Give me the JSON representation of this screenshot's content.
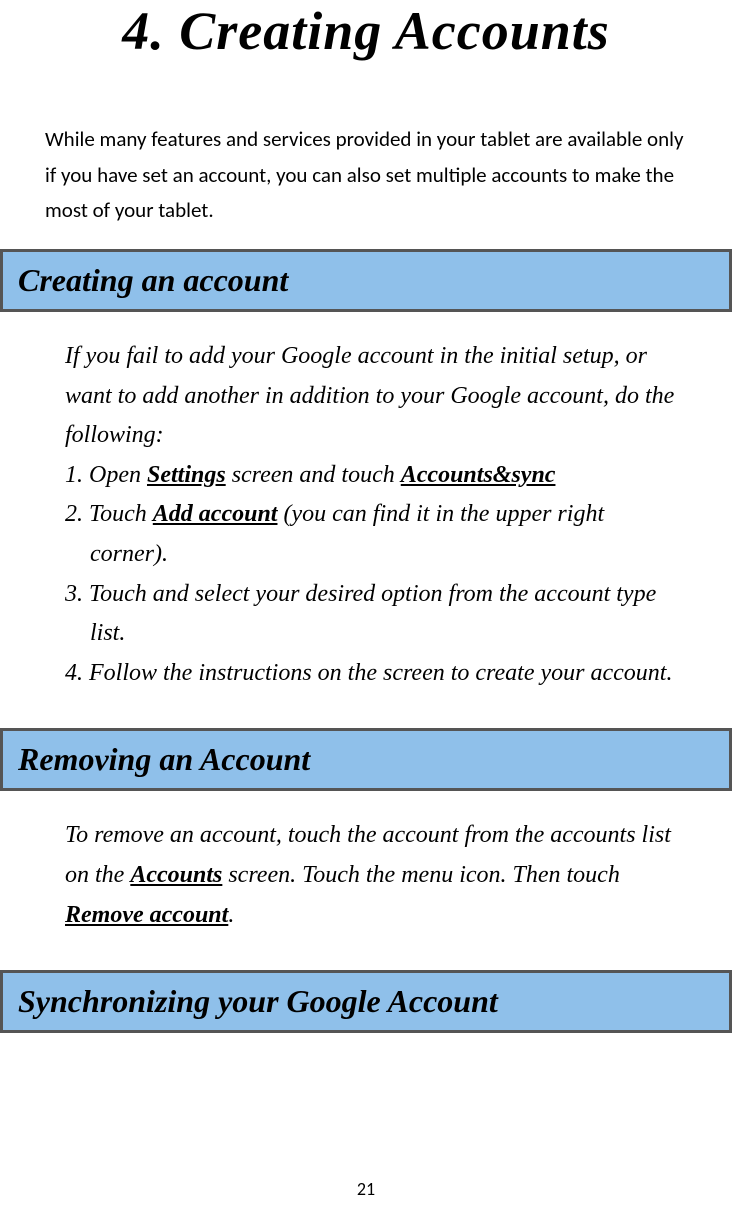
{
  "chapter": {
    "title": "4. Creating Accounts"
  },
  "intro": "While many features and services provided in your tablet are available only if you have set an account, you can also set multiple accounts to make the most of your tablet.",
  "section1": {
    "heading": "Creating an account",
    "lead": "If you fail to add your Google account in the initial setup, or want to add another in addition to your Google account, do the following:",
    "step1_pre": "1. Open ",
    "step1_bold1": "Settings",
    "step1_mid": " screen and touch ",
    "step1_bold2": "Accounts&sync",
    "step2_pre": "2. Touch ",
    "step2_bold": "Add account",
    "step2_post": " (you can find it in the upper right corner).",
    "step3": "3. Touch and select your desired option from the account type list.",
    "step4": "4. Follow the instructions on the screen to create your account."
  },
  "section2": {
    "heading": "Removing an Account",
    "body_pre": "To remove an account, touch the account from the accounts list on the ",
    "body_bold1": "Accounts",
    "body_mid": " screen. Touch the menu icon. Then touch ",
    "body_bold2": "Remove account",
    "body_post": "."
  },
  "section3": {
    "heading": "Synchronizing your Google Account"
  },
  "pageNumber": "21"
}
